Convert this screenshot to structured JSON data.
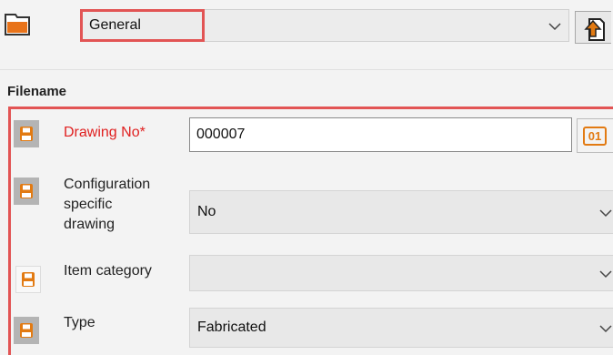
{
  "toolbar": {
    "selected_tab": "General",
    "folder_icon": "folder-orange-icon",
    "chevron_icon": "chevron-down-icon",
    "upload_icon": "document-arrow-icon"
  },
  "section": {
    "title": "Filename"
  },
  "fields": {
    "drawing_no": {
      "label": "Drawing No*",
      "value": "000007",
      "numbering_button": "01",
      "required": true
    },
    "configuration": {
      "label_lines": [
        "Configuration",
        "specific",
        "drawing"
      ],
      "value": "No"
    },
    "item_category": {
      "label": "Item category",
      "value": ""
    },
    "type": {
      "label": "Type",
      "value": "Fabricated"
    }
  },
  "colors": {
    "highlight_red": "#e25454",
    "required_label": "#e02020",
    "icon_orange": "#e27a12"
  }
}
